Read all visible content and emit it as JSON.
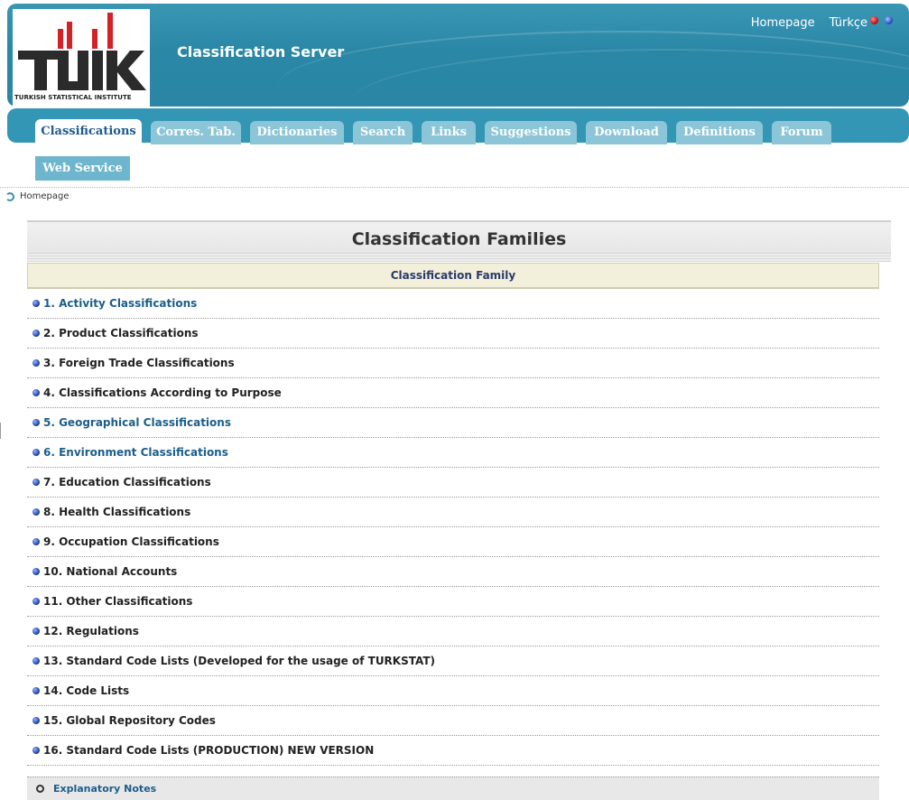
{
  "header": {
    "app_title": "Classification Server",
    "logo_text": "TÜİK",
    "logo_subtitle": "TURKISH STATISTICAL INSTITUTE",
    "top_links": [
      "Homepage",
      "Türkçe"
    ],
    "brand_color": "#2a87a6",
    "logo_red": "#d42027"
  },
  "tabs": [
    {
      "label": "Classifications",
      "active": true
    },
    {
      "label": "Corres. Tab.",
      "active": false
    },
    {
      "label": "Dictionaries",
      "active": false
    },
    {
      "label": "Search",
      "active": false
    },
    {
      "label": "Links",
      "active": false
    },
    {
      "label": "Suggestions",
      "active": false
    },
    {
      "label": "Download",
      "active": false
    },
    {
      "label": "Definitions",
      "active": false
    },
    {
      "label": "Forum",
      "active": false
    }
  ],
  "web_service_label": "Web Service",
  "breadcrumb": "Homepage",
  "families": {
    "title": "Classification Families",
    "column_header": "Classification Family",
    "items": [
      {
        "label": "1. Activity Classifications",
        "link": true
      },
      {
        "label": "2. Product Classifications",
        "link": false
      },
      {
        "label": "3. Foreign Trade Classifications",
        "link": false
      },
      {
        "label": "4. Classifications According to Purpose",
        "link": false
      },
      {
        "label": "5. Geographical Classifications",
        "link": true
      },
      {
        "label": "6. Environment Classifications",
        "link": true
      },
      {
        "label": "7. Education Classifications",
        "link": false
      },
      {
        "label": "8. Health Classifications",
        "link": false
      },
      {
        "label": "9. Occupation Classifications",
        "link": false
      },
      {
        "label": "10. National Accounts",
        "link": false
      },
      {
        "label": "11. Other Classifications",
        "link": false
      },
      {
        "label": "12. Regulations",
        "link": false
      },
      {
        "label": "13. Standard Code Lists (Developed for the usage of TURKSTAT)",
        "link": false
      },
      {
        "label": "14. Code Lists",
        "link": false
      },
      {
        "label": "15. Global Repository Codes",
        "link": false
      },
      {
        "label": "16. Standard Code Lists (PRODUCTION) NEW VERSION",
        "link": false
      }
    ]
  },
  "explanatory_notes": "Explanatory Notes"
}
